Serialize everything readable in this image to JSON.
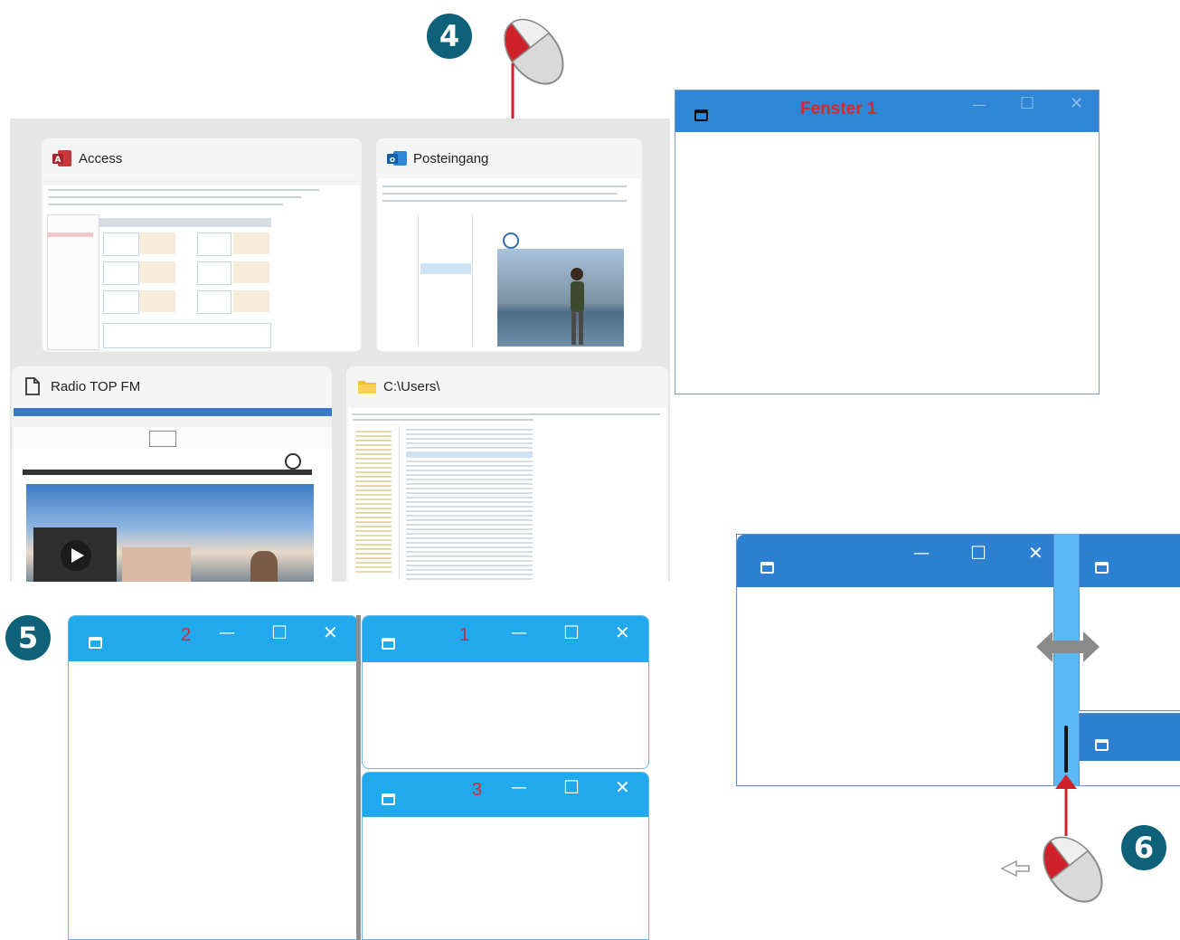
{
  "badges": {
    "step4": "4",
    "step5": "5",
    "step6": "6"
  },
  "snap_assist": {
    "thumbnails": [
      {
        "title": "Access",
        "icon": "access-icon"
      },
      {
        "title": "Posteingang",
        "icon": "outlook-icon"
      },
      {
        "title": "Radio TOP FM",
        "icon": "document-icon"
      },
      {
        "title": "C:\\Users\\",
        "icon": "folder-icon"
      }
    ]
  },
  "window_fenster1": {
    "title": "Fenster 1",
    "minimize": "—",
    "maximize": "☐",
    "close": "✕"
  },
  "snap_layout": {
    "left_window": {
      "number": "2",
      "minimize": "—",
      "maximize": "☐",
      "close": "✕"
    },
    "top_right_window": {
      "number": "1",
      "minimize": "—",
      "maximize": "☐",
      "close": "✕"
    },
    "bottom_right_window": {
      "number": "3",
      "minimize": "—",
      "maximize": "☐",
      "close": "✕"
    }
  },
  "resize_demo": {
    "minimize": "—",
    "maximize": "☐",
    "close": "✕"
  },
  "colors": {
    "badge": "#0d6279",
    "titlebar_blue": "#2f86d6",
    "titlebar_cyan": "#21a9ee",
    "divider_light": "#5ab8f4",
    "arrow_red": "#d0202a",
    "title_red": "#d42a2a"
  }
}
